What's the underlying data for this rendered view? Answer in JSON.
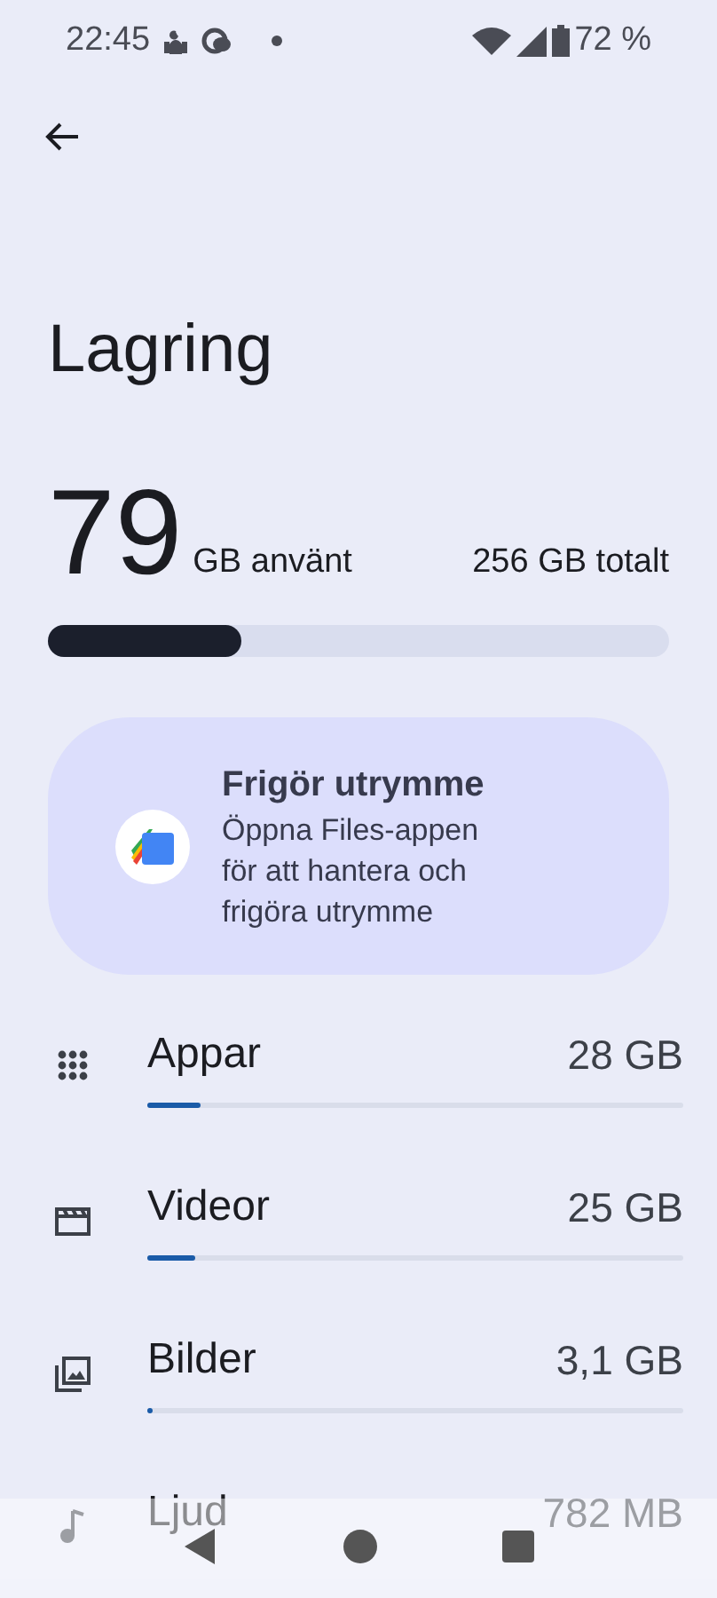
{
  "status_bar": {
    "time": "22:45",
    "battery": "72 %"
  },
  "title": "Lagring",
  "usage": {
    "used": "79",
    "used_label": "GB använt",
    "total": "256 GB totalt",
    "level": 0.31
  },
  "promo": {
    "title": "Frigör utrymme",
    "text": "Öppna Files-appen för att hantera och frigöra utrymme"
  },
  "categories": [
    {
      "kind": "apps",
      "name": "Appar",
      "size": "28 GB",
      "level": 0.1
    },
    {
      "kind": "video",
      "name": "Videor",
      "size": "25 GB",
      "level": 0.09
    },
    {
      "kind": "images",
      "name": "Bilder",
      "size": "3,1 GB",
      "level": 0.01
    },
    {
      "kind": "audio",
      "name": "Ljud",
      "size": "782 MB"
    }
  ]
}
